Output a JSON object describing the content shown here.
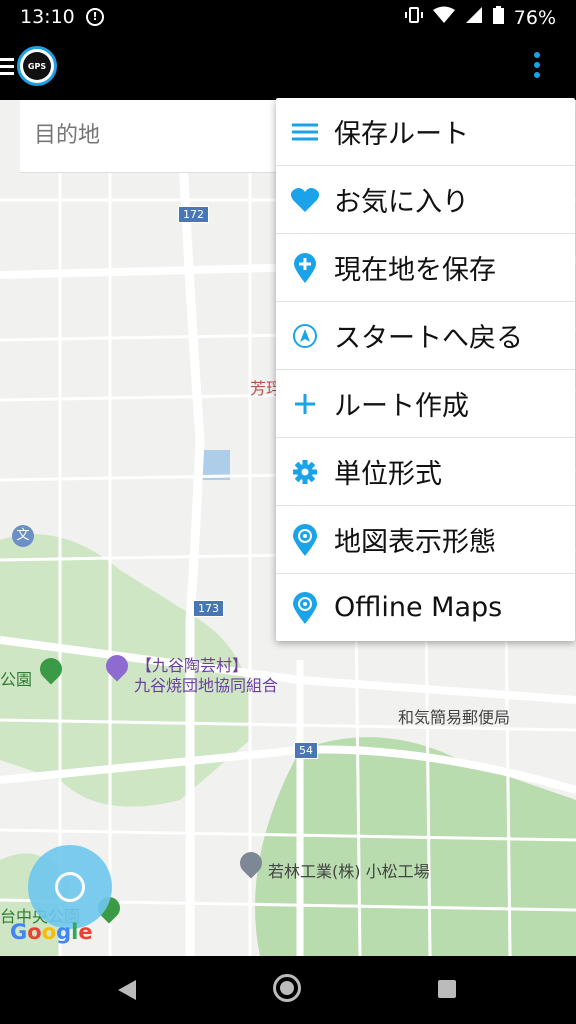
{
  "status_bar": {
    "time": "13:10",
    "battery": "76%",
    "icons": [
      "alert-icon",
      "vibrate-icon",
      "wifi-icon",
      "signal-icon",
      "battery-icon"
    ]
  },
  "app_bar": {
    "logo_text": "GPS",
    "icons": [
      "menu-icon",
      "overflow-menu-icon"
    ],
    "accent": "#1aa3e8"
  },
  "search": {
    "placeholder": "目的地"
  },
  "menu": {
    "items": [
      {
        "label": "保存ルート",
        "icon": "list-icon"
      },
      {
        "label": "お気に入り",
        "icon": "heart-icon"
      },
      {
        "label": "現在地を保存",
        "icon": "add-location-icon"
      },
      {
        "label": "スタートへ戻る",
        "icon": "navigation-icon"
      },
      {
        "label": "ルート作成",
        "icon": "plus-icon"
      },
      {
        "label": "単位形式",
        "icon": "gear-icon"
      },
      {
        "label": "地図表示形態",
        "icon": "map-pin-icon"
      },
      {
        "label": "Offline Maps",
        "icon": "map-pin-icon"
      }
    ]
  },
  "map": {
    "labels": {
      "road_172": "172",
      "road_173": "173",
      "road_54": "54",
      "partial_name": "芳琈",
      "kutani_village": "【九谷陶芸村】",
      "kutani_association": "九谷焼団地協同組合",
      "park_left": "公園",
      "post_office": "和気簡易郵便局",
      "factory": "若林工業(株) 小松工場",
      "central_park": "台中央公園",
      "google": "Google",
      "text_icon": "文"
    },
    "colors": {
      "background": "#f1f1ef",
      "green": "#b9dcae",
      "road": "#ffffff"
    }
  },
  "nav_bar": {
    "icons": [
      "back-icon",
      "home-icon",
      "recents-icon"
    ]
  }
}
